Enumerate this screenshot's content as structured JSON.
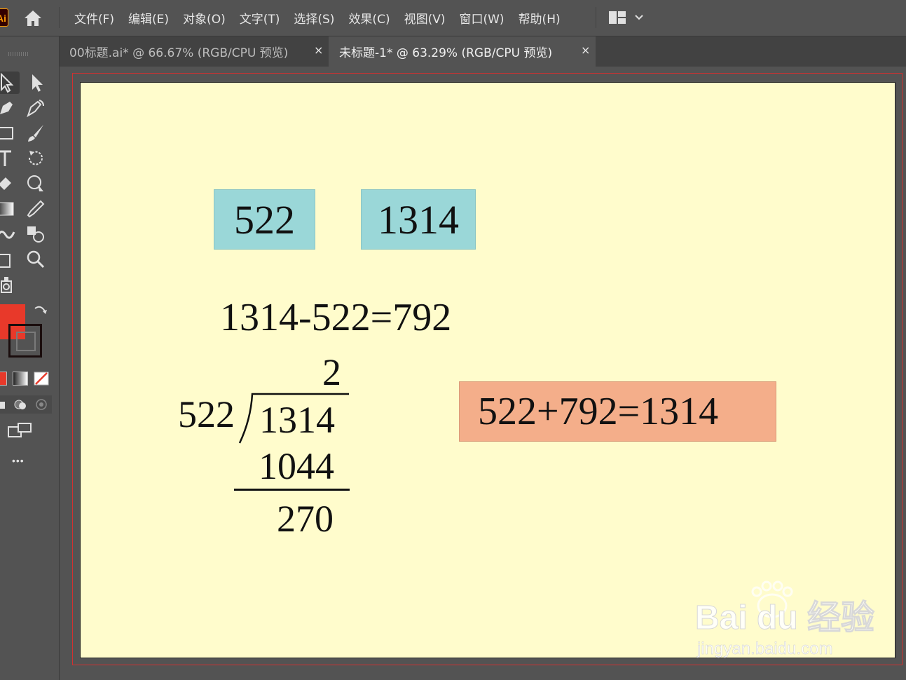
{
  "app": {
    "logo_text": "Ai",
    "menu": [
      "文件(F)",
      "编辑(E)",
      "对象(O)",
      "文字(T)",
      "选择(S)",
      "效果(C)",
      "视图(V)",
      "窗口(W)",
      "帮助(H)"
    ]
  },
  "tabs": [
    {
      "label": "00标题.ai* @ 66.67% (RGB/CPU 预览)",
      "close": "×",
      "active": false
    },
    {
      "label": "未标题-1* @ 63.29% (RGB/CPU 预览)",
      "close": "×",
      "active": true
    }
  ],
  "toolbar": {
    "more": "•••"
  },
  "colors": {
    "fill": "#e8392a",
    "stroke": "#2b1a1a",
    "artboard": "#fffccc",
    "box_teal": "#9ad7d8",
    "box_salmon": "#f4ae8a",
    "bleed": "#d23030"
  },
  "artwork": {
    "box1": "522",
    "box2": "1314",
    "equation": "1314-522=792",
    "quotient": "2",
    "divisor": "522",
    "dividend": "1314",
    "product": "1044",
    "remainder": "270",
    "check": "522+792=1314"
  },
  "watermark": {
    "brand": "Bai du 经验",
    "url": "jingyan.baidu.com"
  }
}
